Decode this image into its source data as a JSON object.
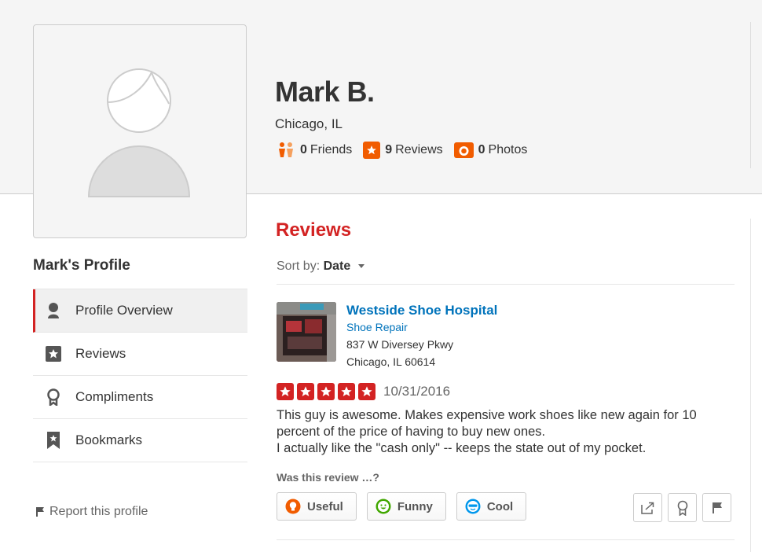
{
  "user": {
    "name": "Mark B.",
    "location": "Chicago, IL",
    "stats": {
      "friends_count": "0",
      "friends_label": "Friends",
      "reviews_count": "9",
      "reviews_label": "Reviews",
      "photos_count": "0",
      "photos_label": "Photos"
    }
  },
  "sidebar": {
    "heading": "Mark's Profile",
    "items": [
      {
        "label": "Profile Overview",
        "icon": "person-icon",
        "active": true
      },
      {
        "label": "Reviews",
        "icon": "star-box-icon",
        "active": false
      },
      {
        "label": "Compliments",
        "icon": "award-icon",
        "active": false
      },
      {
        "label": "Bookmarks",
        "icon": "bookmark-icon",
        "active": false
      }
    ],
    "report_label": "Report this profile"
  },
  "reviews_section": {
    "heading": "Reviews",
    "sort_prefix": "Sort by:",
    "sort_value": "Date"
  },
  "review": {
    "business": {
      "name": "Westside Shoe Hospital",
      "category": "Shoe Repair",
      "address_line1": "837 W Diversey Pkwy",
      "address_line2": "Chicago, IL 60614"
    },
    "rating": 5,
    "date": "10/31/2016",
    "text_lines": [
      "This guy is awesome.  Makes expensive work shoes like new again for 10 percent of the price of having to buy new ones.",
      "I actually like the \"cash only\" -- keeps the state out of my pocket."
    ],
    "vote_prompt": "Was this review …?",
    "votes": [
      {
        "label": "Useful",
        "icon": "lightbulb-icon",
        "color": "#f15c00"
      },
      {
        "label": "Funny",
        "icon": "smiley-icon",
        "color": "#41a700"
      },
      {
        "label": "Cool",
        "icon": "sunglasses-icon",
        "color": "#0097ec"
      }
    ],
    "tools": [
      "share-icon",
      "compliment-icon",
      "flag-icon"
    ]
  },
  "colors": {
    "accent_red": "#d32323",
    "link_blue": "#0073bb",
    "stat_orange": "#f15c00"
  }
}
